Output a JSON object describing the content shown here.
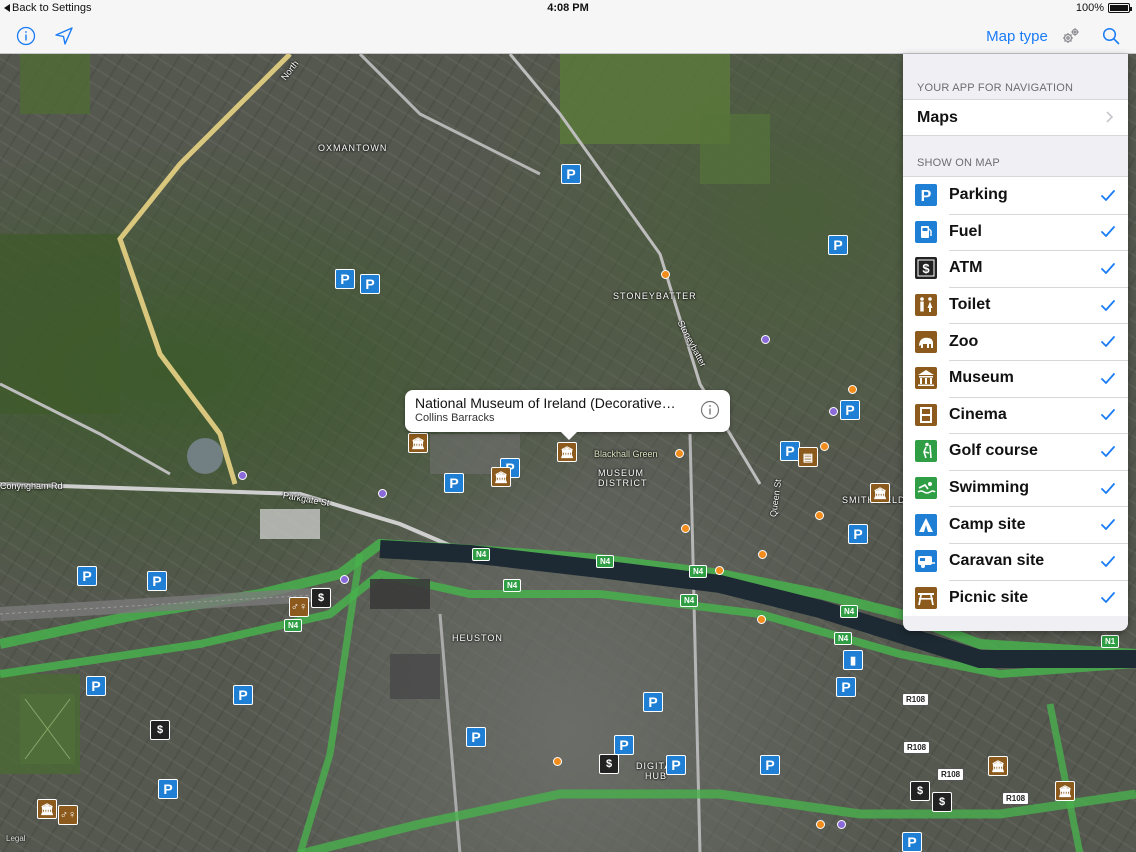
{
  "status_bar": {
    "back_label": "Back to Settings",
    "time": "4:08 PM",
    "battery": "100%",
    "battery_level": 1.0
  },
  "nav_bar": {
    "info_icon": "info-icon",
    "locate_icon": "location-arrow-icon",
    "map_type_label": "Map type",
    "gear_icon": "gear-icon",
    "search_icon": "search-icon",
    "accent_color": "#1a7cf5"
  },
  "map": {
    "area_labels": [
      "OXMANTOWN",
      "STONEYBATTER",
      "MUSEUM",
      "DISTRICT",
      "HEUSTON",
      "SMITHFIELD",
      "DIGITAL",
      "HUB"
    ],
    "road_labels": [
      "North",
      "Stoneybatter",
      "Parkgate St",
      "Queen St",
      "Conyngham Rd",
      "Blackhall Green"
    ],
    "route_shields": [
      "N4",
      "N4",
      "N4",
      "N4",
      "N4",
      "N4",
      "N4",
      "N1",
      "N4"
    ],
    "regional_shields": [
      "R108",
      "R108",
      "R108",
      "R108"
    ],
    "attribution": "Legal"
  },
  "callout": {
    "title": "National Museum of Ireland (Decorative…",
    "subtitle": "Collins Barracks"
  },
  "panel": {
    "nav_section_title": "YOUR APP FOR NAVIGATION",
    "nav_app": "Maps",
    "show_section_title": "SHOW ON MAP",
    "items": [
      {
        "label": "Parking",
        "icon": "parking-icon",
        "checked": true
      },
      {
        "label": "Fuel",
        "icon": "fuel-icon",
        "checked": true
      },
      {
        "label": "ATM",
        "icon": "atm-icon",
        "checked": true
      },
      {
        "label": "Toilet",
        "icon": "toilet-icon",
        "checked": true
      },
      {
        "label": "Zoo",
        "icon": "zoo-icon",
        "checked": true
      },
      {
        "label": "Museum",
        "icon": "museum-icon",
        "checked": true
      },
      {
        "label": "Cinema",
        "icon": "cinema-icon",
        "checked": true
      },
      {
        "label": "Golf course",
        "icon": "golf-icon",
        "checked": true
      },
      {
        "label": "Swimming",
        "icon": "swimming-icon",
        "checked": true
      },
      {
        "label": "Camp site",
        "icon": "camp-site-icon",
        "checked": true
      },
      {
        "label": "Caravan site",
        "icon": "caravan-icon",
        "checked": true
      },
      {
        "label": "Picnic site",
        "icon": "picnic-icon",
        "checked": true
      }
    ]
  }
}
